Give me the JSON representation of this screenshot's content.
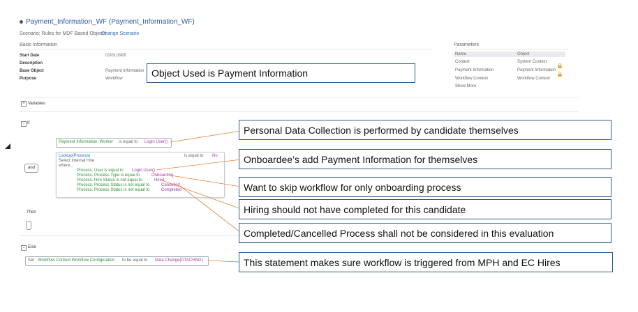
{
  "header": {
    "title": "Payment_Information_WF (Payment_Information_WF)",
    "scenario_label": "Scenario: Rules for MDF Based Objects",
    "change_scenario": "Change Scenario"
  },
  "basic_info": {
    "heading": "Basic Information",
    "rows": [
      {
        "label": "Start Date",
        "value": "01/01/1900"
      },
      {
        "label": "Description",
        "value": ""
      },
      {
        "label": "Base Object",
        "value": "Payment Information"
      },
      {
        "label": "Purpose",
        "value": "Workflow"
      }
    ]
  },
  "parameters": {
    "heading": "Parameters",
    "col_name": "Name",
    "col_object": "Object",
    "rows": [
      {
        "name": "Context",
        "object": "System Context"
      },
      {
        "name": "Payment Information",
        "object": "Payment Information"
      },
      {
        "name": "Workflow Context",
        "object": "Workflow Context"
      }
    ],
    "show_more": "Show More"
  },
  "variables_label": "Variables",
  "if_section": {
    "label": "If",
    "condition": {
      "left": "Payment Information .Worker",
      "op": "is equal to",
      "right": "Login User()"
    },
    "and_label": "and",
    "lookup": {
      "title": "Lookup(Process)",
      "is_equal": "is equal to",
      "no": "No",
      "select": "Select Internal Hire",
      "where": "where...",
      "lines": [
        {
          "left": "Process. User is equal to",
          "right": "Login User()"
        },
        {
          "left": "Process. Process Type is equal to",
          "right": "Onboarding"
        },
        {
          "left": "Process. Hire Status is not equal to",
          "right": "Hired"
        },
        {
          "left": "Process. Process Status is not equal to",
          "right": "Cancelled"
        },
        {
          "left": "Process. Process Status is not equal to",
          "right": "Completed"
        }
      ]
    },
    "then_label": "Then"
  },
  "else_section": {
    "label": "Else",
    "set": "Set",
    "field": "Workflow Context.Workflow Configuration",
    "op": "to be equal to",
    "value": "Data Change(DTACHNG)"
  },
  "callouts": {
    "object_used": "Object Used is Payment Information",
    "personal_data": "Personal Data Collection is performed by candidate themselves",
    "onboardee": "Onboardee’s add Payment Information for themselves",
    "skip_workflow": "Want to skip workflow for only onboarding process",
    "hiring": "Hiring should not have completed for this candidate",
    "completed_cancelled": "Completed/Cancelled Process shall not be considered in this evaluation",
    "triggered": "This statement makes sure workflow is triggered from MPH and EC Hires"
  },
  "colors": {
    "callout_border": "#2e5c8a",
    "connector": "#e8823a",
    "link": "#2d6db5"
  }
}
